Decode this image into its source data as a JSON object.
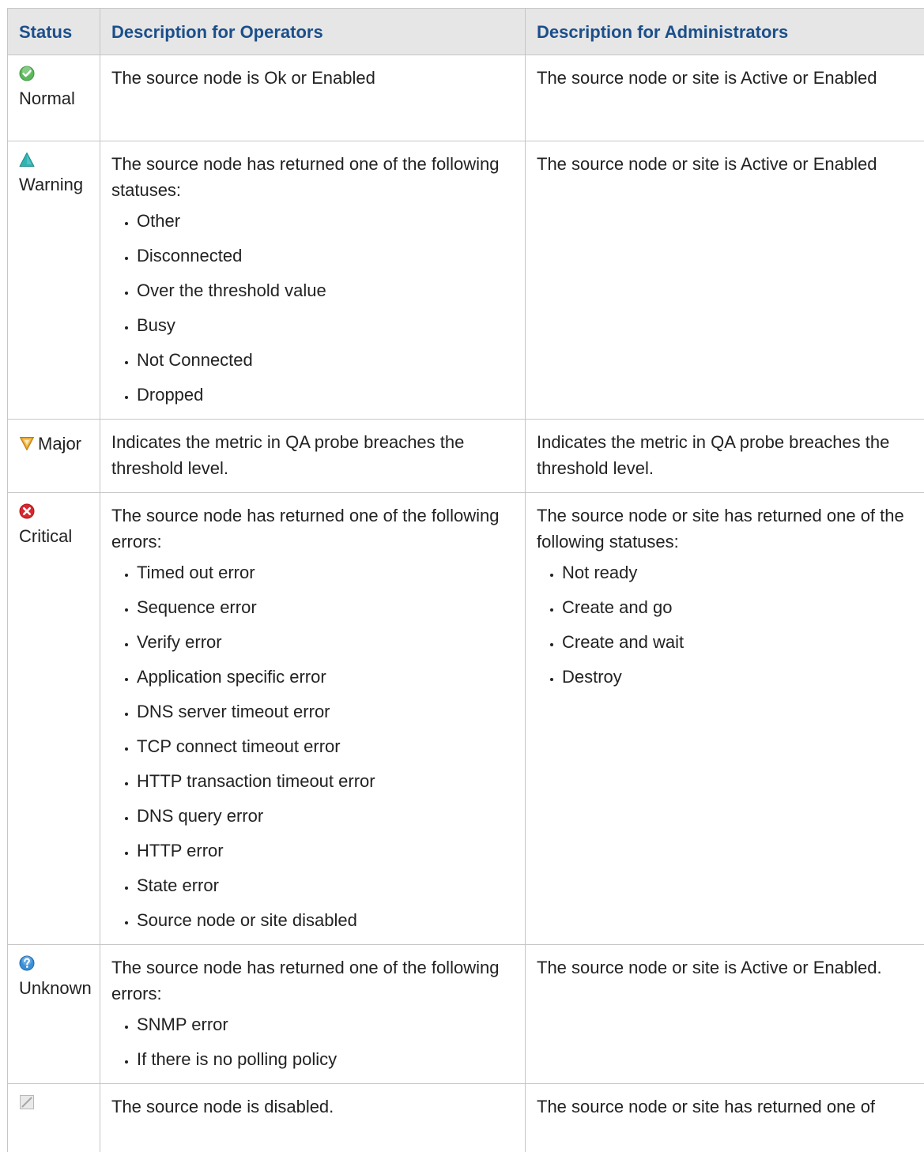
{
  "table": {
    "headers": {
      "status": "Status",
      "operators": "Description for Operators",
      "administrators": "Description for Administrators"
    },
    "rows": [
      {
        "status_label": "Normal",
        "status_icon": "normal-check-icon",
        "operators_text": "The source node is Ok or Enabled",
        "operators_items": [],
        "admins_text": "The source node or site is Active or Enabled",
        "admins_items": []
      },
      {
        "status_label": "Warning",
        "status_icon": "warning-triangle-icon",
        "operators_text": "The source node has returned one of the following statuses:",
        "operators_items": [
          "Other",
          "Disconnected",
          "Over the threshold value",
          "Busy",
          "Not Connected",
          "Dropped"
        ],
        "admins_text": "The source node or site is Active or Enabled",
        "admins_items": []
      },
      {
        "status_label": "Major",
        "status_icon": "major-shield-icon",
        "operators_text": "Indicates the metric in QA probe breaches the threshold level.",
        "operators_items": [],
        "admins_text": "Indicates the metric in QA probe breaches the threshold level.",
        "admins_items": []
      },
      {
        "status_label": "Critical",
        "status_icon": "critical-x-icon",
        "operators_text": "The source node has returned one of the following errors:",
        "operators_items": [
          "Timed out error",
          "Sequence error",
          "Verify error",
          "Application specific error",
          "DNS server timeout error",
          "TCP connect timeout error",
          "HTTP transaction timeout error",
          "DNS query error",
          "HTTP error",
          "State error",
          "Source node or site disabled"
        ],
        "admins_text": "The source node or site has returned one of the following statuses:",
        "admins_items": [
          "Not ready",
          "Create and go",
          "Create and wait",
          "Destroy"
        ]
      },
      {
        "status_label": "Unknown",
        "status_icon": "unknown-question-icon",
        "operators_text": "The source node has returned one of the following errors:",
        "operators_items": [
          "SNMP error",
          "If there is no polling policy"
        ],
        "admins_text": "The source node or site is Active or Enabled.",
        "admins_items": []
      },
      {
        "status_label": "",
        "status_icon": "disabled-slash-icon",
        "operators_text": "The source node is disabled.",
        "operators_items": [],
        "admins_text": "The source node or site has returned one of",
        "admins_items": []
      }
    ]
  },
  "colors": {
    "header_bg": "#e6e6e6",
    "header_text": "#1b4f8a",
    "border": "#c6c6c6",
    "normal": "#5cb85c",
    "warning": "#2fb3b3",
    "major": "#e8a526",
    "critical": "#d9272e",
    "unknown": "#3a8fd9",
    "disabled": "#b8b8b8"
  }
}
